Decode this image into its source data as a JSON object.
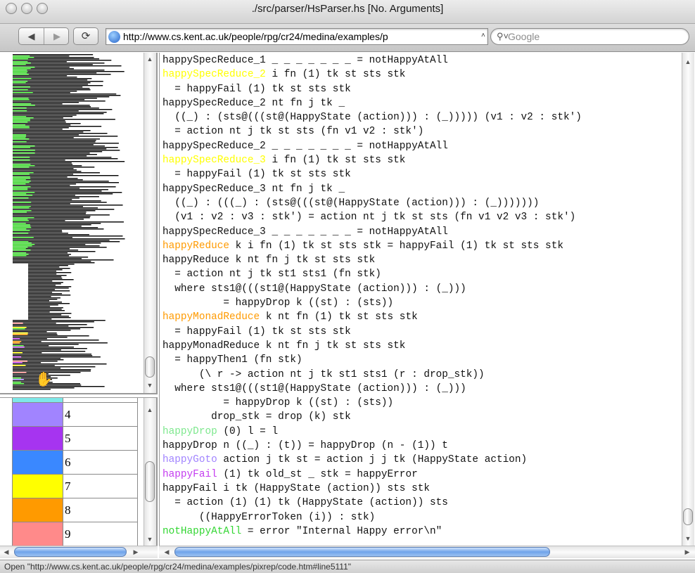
{
  "window": {
    "title": "./src/parser/HsParser.hs [No. Arguments]"
  },
  "toolbar": {
    "back_icon": "back-arrow-icon",
    "forward_icon": "forward-arrow-icon",
    "reload_icon": "reload-icon",
    "url": "http://www.cs.kent.ac.uk/people/rpg/cr24/medina/examples/p",
    "search_placeholder": "Google"
  },
  "legend": {
    "rows": [
      {
        "label": "",
        "color": "#7ee8e8"
      },
      {
        "label": "4",
        "color": "#a184ff"
      },
      {
        "label": "5",
        "color": "#a634f0"
      },
      {
        "label": "6",
        "color": "#3a88ff"
      },
      {
        "label": "7",
        "color": "#ffff00"
      },
      {
        "label": "8",
        "color": "#ff9a00"
      },
      {
        "label": "9",
        "color": "#ff8a8a"
      }
    ]
  },
  "code": {
    "lines": [
      [
        {
          "t": "happySpecReduce_1 _ _ _ _ _ _ _ = notHappyAtAll"
        }
      ],
      [
        {
          "t": "happySpecReduce_2",
          "c": "#ffff00"
        },
        {
          "t": " i fn (1) tk st sts stk"
        }
      ],
      [
        {
          "t": "  = happyFail (1) tk st sts stk"
        }
      ],
      [
        {
          "t": "happySpecReduce_2 nt fn j tk _"
        }
      ],
      [
        {
          "t": "  ((_) : (sts@(((st@(HappyState (action))) : (_))))) (v1 : v2 : stk')"
        }
      ],
      [
        {
          "t": "  = action nt j tk st sts (fn v1 v2 : stk')"
        }
      ],
      [
        {
          "t": "happySpecReduce_2 _ _ _ _ _ _ _ = notHappyAtAll"
        }
      ],
      [
        {
          "t": "happySpecReduce_3",
          "c": "#ffff00"
        },
        {
          "t": " i fn (1) tk st sts stk"
        }
      ],
      [
        {
          "t": "  = happyFail (1) tk st sts stk"
        }
      ],
      [
        {
          "t": "happySpecReduce_3 nt fn j tk _"
        }
      ],
      [
        {
          "t": "  ((_) : (((_) : (sts@(((st@(HappyState (action))) : (_)))))))"
        }
      ],
      [
        {
          "t": "  (v1 : v2 : v3 : stk') = action nt j tk st sts (fn v1 v2 v3 : stk')"
        }
      ],
      [
        {
          "t": "happySpecReduce_3 _ _ _ _ _ _ _ = notHappyAtAll"
        }
      ],
      [
        {
          "t": "happyReduce",
          "c": "#ff9a00"
        },
        {
          "t": " k i fn (1) tk st sts stk = happyFail (1) tk st sts stk"
        }
      ],
      [
        {
          "t": "happyReduce k nt fn j tk st sts stk"
        }
      ],
      [
        {
          "t": "  = action nt j tk st1 sts1 (fn stk)"
        }
      ],
      [
        {
          "t": "  where sts1@(((st1@(HappyState (action))) : (_)))"
        }
      ],
      [
        {
          "t": "          = happyDrop k ((st) : (sts))"
        }
      ],
      [
        {
          "t": "happyMonadReduce",
          "c": "#ff9a00"
        },
        {
          "t": " k nt fn (1) tk st sts stk"
        }
      ],
      [
        {
          "t": "  = happyFail (1) tk st sts stk"
        }
      ],
      [
        {
          "t": "happyMonadReduce k nt fn j tk st sts stk"
        }
      ],
      [
        {
          "t": "  = happyThen1 (fn stk)"
        }
      ],
      [
        {
          "t": "      (\\ r -> action nt j tk st1 sts1 (r : drop_stk))"
        }
      ],
      [
        {
          "t": "  where sts1@(((st1@(HappyState (action))) : (_)))"
        }
      ],
      [
        {
          "t": "          = happyDrop k ((st) : (sts))"
        }
      ],
      [
        {
          "t": "        drop_stk = drop (k) stk"
        }
      ],
      [
        {
          "t": "happyDrop",
          "c": "#7ee88e"
        },
        {
          "t": " (0) l = l"
        }
      ],
      [
        {
          "t": "happyDrop n ((_) : (t)) = happyDrop (n - (1)) t"
        }
      ],
      [
        {
          "t": "happyGoto",
          "c": "#a184ff"
        },
        {
          "t": " action j tk st = action j j tk (HappyState action)"
        }
      ],
      [
        {
          "t": "happyFail",
          "c": "#c43cf0"
        },
        {
          "t": " (1) tk old_st _ stk = happyError"
        }
      ],
      [
        {
          "t": "happyFail i tk (HappyState (action)) sts stk"
        }
      ],
      [
        {
          "t": "  = action (1) (1) tk (HappyState (action)) sts"
        }
      ],
      [
        {
          "t": "      ((HappyErrorToken (i)) : stk)"
        }
      ],
      [
        {
          "t": "notHappyAtAll",
          "c": "#33d633"
        },
        {
          "t": " = error \"Internal Happy error\\n\""
        }
      ]
    ]
  },
  "status": {
    "text": "Open \"http://www.cs.kent.ac.uk/people/rpg/cr24/medina/examples/pixrep/code.htm#line5111\""
  },
  "icons": {
    "traffic_lights": [
      "close-icon",
      "minimize-icon",
      "zoom-icon"
    ],
    "globe": "globe-icon",
    "cursor": "hand-cursor-icon"
  }
}
